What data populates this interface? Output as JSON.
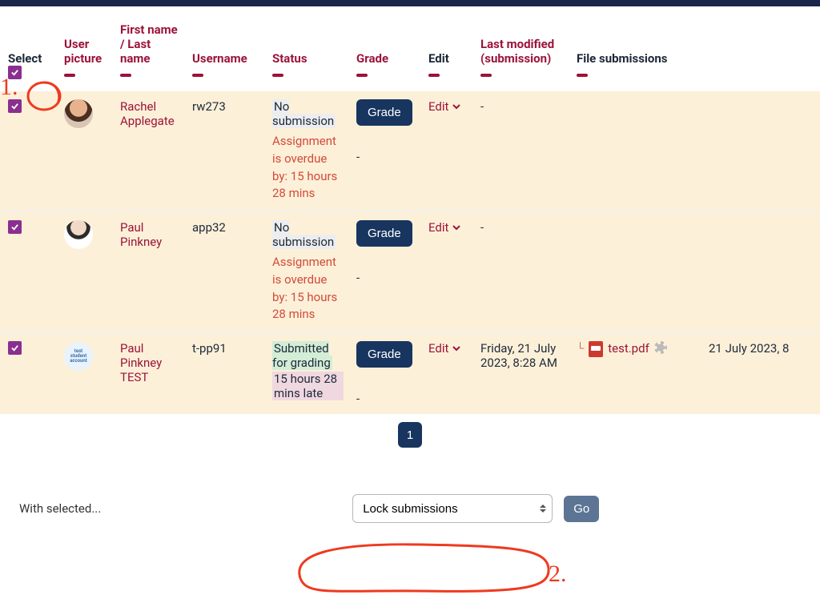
{
  "headers": {
    "select": "Select",
    "picture": "User picture",
    "first": "First name",
    "slash": " / ",
    "last": "Last name",
    "username": "Username",
    "status": "Status",
    "grade": "Grade",
    "edit": "Edit",
    "modified": "Last modified (submission)",
    "files": "File submissions"
  },
  "rows": [
    {
      "name": "Rachel Applegate",
      "username": "rw273",
      "status_main": "No submission",
      "status_sub": "Assignment is overdue by: 15 hours 28 mins",
      "grade_btn": "Grade",
      "grade_val": "-",
      "edit": "Edit",
      "modified": "-",
      "file_name": "",
      "file_date": ""
    },
    {
      "name": "Paul Pinkney",
      "username": "app32",
      "status_main": "No submission",
      "status_sub": "Assignment is overdue by: 15 hours 28 mins",
      "grade_btn": "Grade",
      "grade_val": "-",
      "edit": "Edit",
      "modified": "-",
      "file_name": "",
      "file_date": ""
    },
    {
      "name": "Paul Pinkney TEST",
      "username": "t-pp91",
      "status_main": "Submitted for grading",
      "status_sub": "15 hours 28 mins late",
      "grade_btn": "Grade",
      "grade_val": "-",
      "edit": "Edit",
      "modified": "Friday, 21 July 2023, 8:28 AM",
      "file_name": "test.pdf",
      "file_date": "21 July 2023, 8"
    }
  ],
  "pager": {
    "page": "1"
  },
  "controls": {
    "label": "With selected...",
    "select_value": "Lock submissions",
    "go": "Go"
  },
  "annotations": {
    "one": "1.",
    "two": "2."
  }
}
